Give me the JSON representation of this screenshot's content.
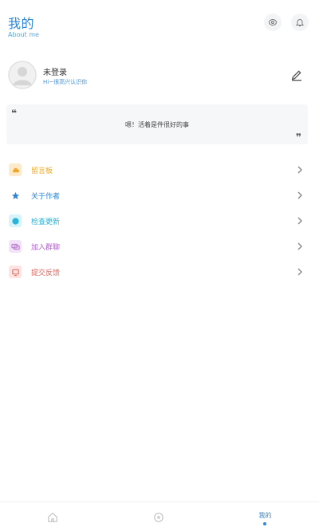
{
  "header": {
    "title": "我的",
    "subtitle": "About me",
    "icons": [
      "eye-icon",
      "bell-icon"
    ]
  },
  "profile": {
    "name": "未登录",
    "motto": "Hi~很高兴认识你"
  },
  "quote": {
    "text": "嗯！活着是件很好的事"
  },
  "menu": [
    {
      "label": "留言板",
      "color": "#f0a92d",
      "bg": "#fdeacb",
      "icon": "cloud-icon"
    },
    {
      "label": "关于作者",
      "color": "#2f86d4",
      "bg": "#ffffff",
      "icon": "star-icon"
    },
    {
      "label": "检查更新",
      "color": "#2ab3d6",
      "bg": "#d8f4fb",
      "icon": "update-icon"
    },
    {
      "label": "加入群聊",
      "color": "#b35fd0",
      "bg": "#f2e3f8",
      "icon": "group-chat-icon"
    },
    {
      "label": "提交反馈",
      "color": "#e0645a",
      "bg": "#fde3e1",
      "icon": "feedback-icon"
    }
  ],
  "tabbar": {
    "active_label": "我的",
    "active_color": "#2f86d4",
    "tabs": [
      "home-icon",
      "compass-icon",
      "me"
    ]
  }
}
